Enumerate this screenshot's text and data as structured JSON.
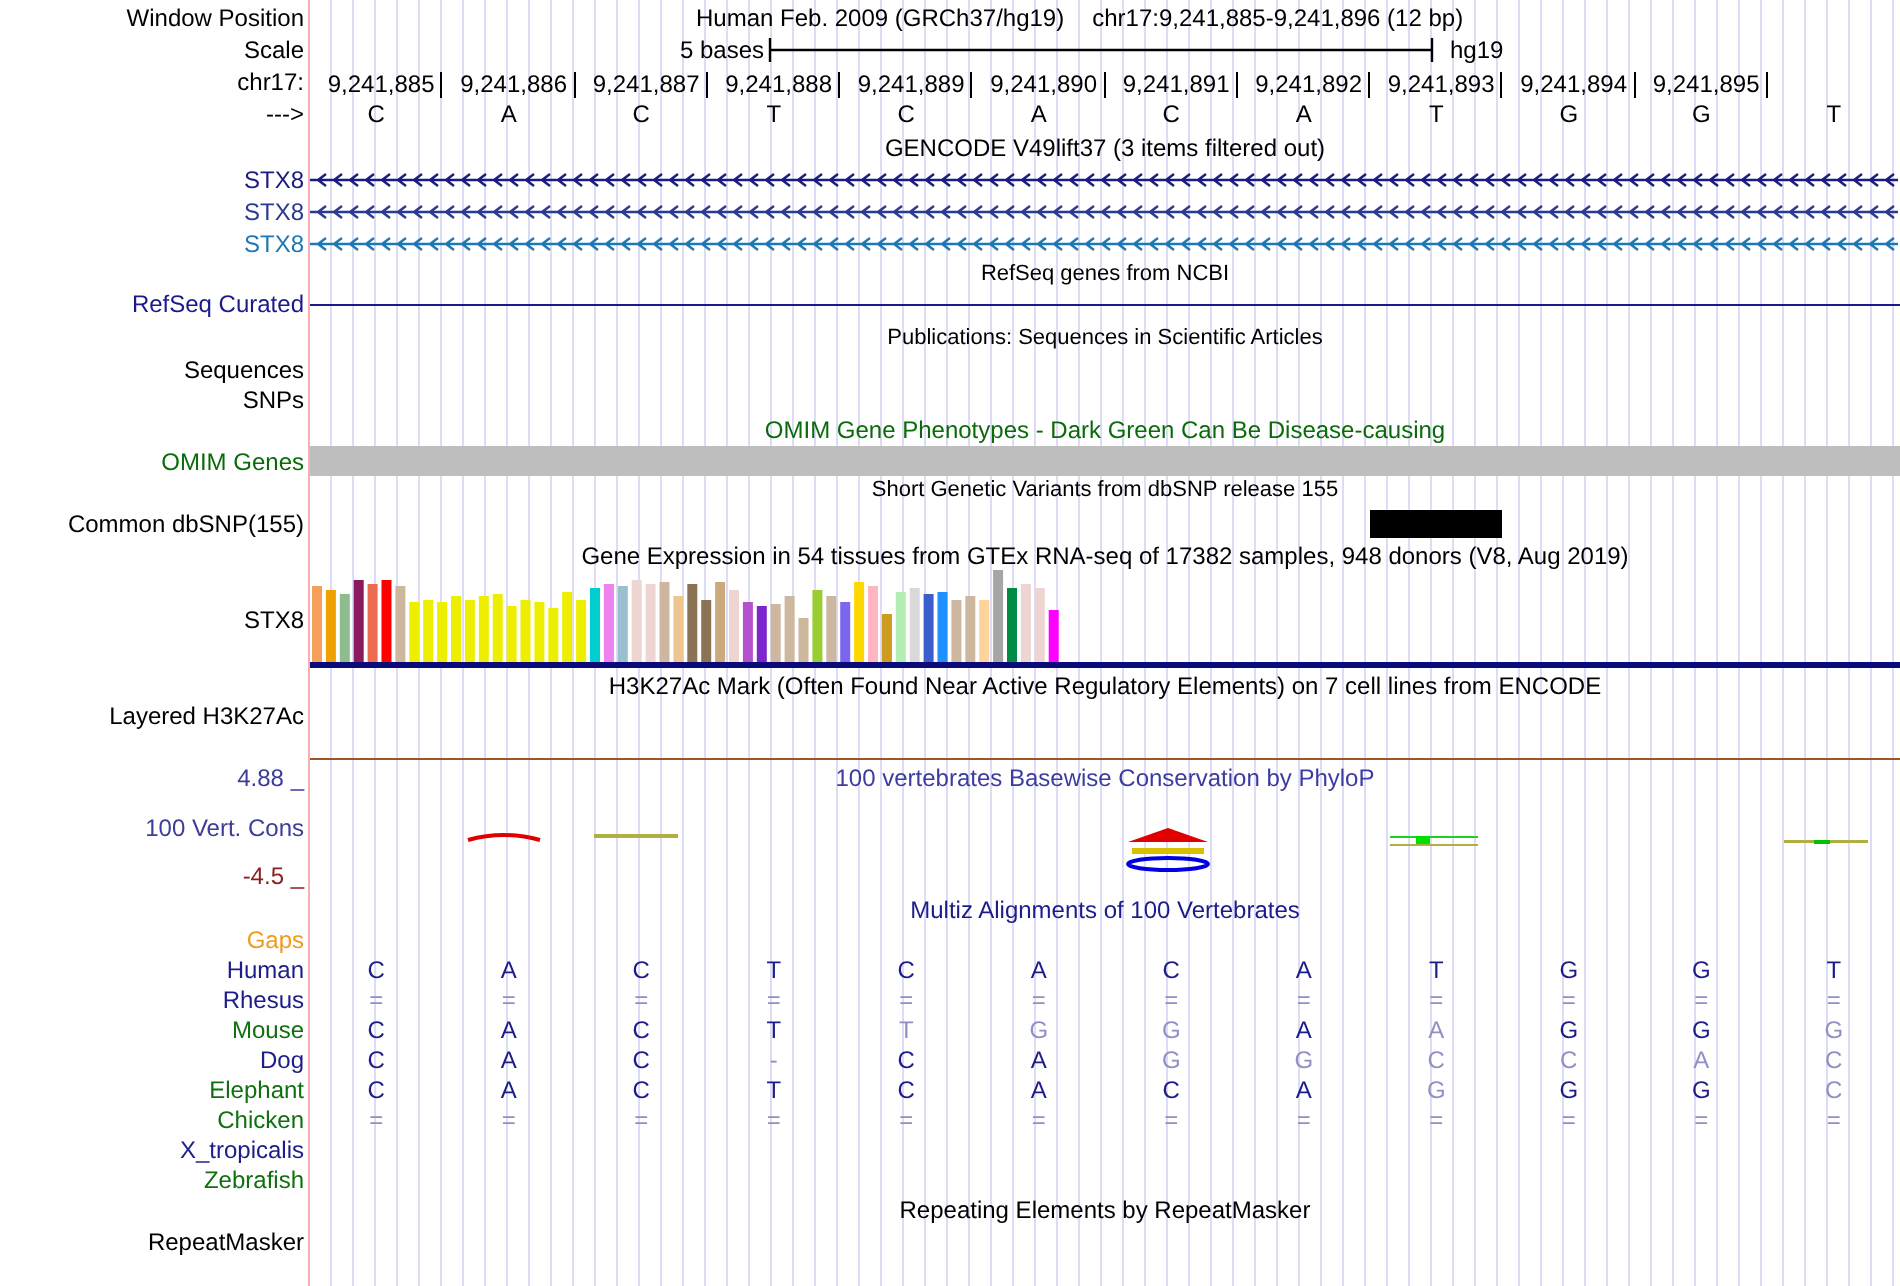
{
  "header": {
    "position_label": "Window Position",
    "title": "Human Feb. 2009 (GRCh37/hg19)",
    "range": "chr17:9,241,885-9,241,896 (12 bp)",
    "scale_label": "Scale",
    "scale_text": "5 bases",
    "assembly": "hg19",
    "chrom_label": "chr17:",
    "positions": [
      "9,241,885",
      "9,241,886",
      "9,241,887",
      "9,241,888",
      "9,241,889",
      "9,241,890",
      "9,241,891",
      "9,241,892",
      "9,241,893",
      "9,241,894",
      "9,241,895"
    ],
    "strand_label": "--->",
    "bases": [
      "C",
      "A",
      "C",
      "T",
      "C",
      "A",
      "C",
      "A",
      "T",
      "G",
      "G",
      "T"
    ]
  },
  "tracks": [
    {
      "kind": "gencode",
      "title": "GENCODE V49lift37 (3 items filtered out)",
      "genes": [
        {
          "label": "STX8",
          "color": "#1c1c80"
        },
        {
          "label": "STX8",
          "color": "#2b3990"
        },
        {
          "label": "STX8",
          "color": "#1f78b4"
        }
      ]
    },
    {
      "kind": "refseq",
      "title": "RefSeq genes from NCBI",
      "label": "RefSeq Curated"
    },
    {
      "kind": "publications",
      "title": "Publications: Sequences in Scientific Articles",
      "labels": [
        "Sequences",
        "SNPs"
      ]
    },
    {
      "kind": "omim",
      "title": "OMIM Gene Phenotypes - Dark Green Can Be Disease-causing",
      "label": "OMIM Genes"
    },
    {
      "kind": "dbsnp",
      "title": "Short Genetic Variants from dbSNP release 155",
      "label": "Common dbSNP(155)"
    },
    {
      "kind": "gtex",
      "title": "Gene Expression in 54 tissues from GTEx RNA-seq of 17382 samples, 948 donors (V8, Aug 2019)",
      "label": "STX8"
    },
    {
      "kind": "h3k27ac",
      "title": "H3K27Ac Mark (Often Found Near Active Regulatory Elements) on 7 cell lines from ENCODE",
      "label": "Layered H3K27Ac"
    },
    {
      "kind": "phylop",
      "title": "100 vertebrates Basewise Conservation by PhyloP",
      "label": "100 Vert. Cons",
      "max": "4.88 _",
      "min": "-4.5 _"
    },
    {
      "kind": "multiz",
      "title": "Multiz Alignments of 100 Vertebrates",
      "species": [
        {
          "name": "Gaps",
          "color": "#f09a1a"
        },
        {
          "name": "Human",
          "color": "#1c1c8a",
          "bases": [
            {
              "b": "C",
              "dim": false
            },
            {
              "b": "A",
              "dim": false
            },
            {
              "b": "C",
              "dim": false
            },
            {
              "b": "T",
              "dim": false
            },
            {
              "b": "C",
              "dim": false
            },
            {
              "b": "A",
              "dim": false
            },
            {
              "b": "C",
              "dim": false
            },
            {
              "b": "A",
              "dim": false
            },
            {
              "b": "T",
              "dim": false
            },
            {
              "b": "G",
              "dim": false
            },
            {
              "b": "G",
              "dim": false
            },
            {
              "b": "T",
              "dim": false
            }
          ]
        },
        {
          "name": "Rhesus",
          "color": "#1c1c8a",
          "bases": [
            {
              "b": "=",
              "dim": true
            },
            {
              "b": "=",
              "dim": true
            },
            {
              "b": "=",
              "dim": true
            },
            {
              "b": "=",
              "dim": true
            },
            {
              "b": "=",
              "dim": true
            },
            {
              "b": "=",
              "dim": true
            },
            {
              "b": "=",
              "dim": true
            },
            {
              "b": "=",
              "dim": true
            },
            {
              "b": "=",
              "dim": true
            },
            {
              "b": "=",
              "dim": true
            },
            {
              "b": "=",
              "dim": true
            },
            {
              "b": "=",
              "dim": true
            }
          ]
        },
        {
          "name": "Mouse",
          "color": "#107010",
          "bases": [
            {
              "b": "C",
              "dim": false
            },
            {
              "b": "A",
              "dim": false
            },
            {
              "b": "C",
              "dim": false
            },
            {
              "b": "T",
              "dim": false
            },
            {
              "b": "T",
              "dim": true
            },
            {
              "b": "G",
              "dim": true
            },
            {
              "b": "G",
              "dim": true
            },
            {
              "b": "A",
              "dim": false
            },
            {
              "b": "A",
              "dim": true
            },
            {
              "b": "G",
              "dim": false
            },
            {
              "b": "G",
              "dim": false
            },
            {
              "b": "G",
              "dim": true
            }
          ]
        },
        {
          "name": "Dog",
          "color": "#1c1c8a",
          "bases": [
            {
              "b": "C",
              "dim": false
            },
            {
              "b": "A",
              "dim": false
            },
            {
              "b": "C",
              "dim": false
            },
            {
              "b": "-",
              "dim": true
            },
            {
              "b": "C",
              "dim": false
            },
            {
              "b": "A",
              "dim": false
            },
            {
              "b": "G",
              "dim": true
            },
            {
              "b": "G",
              "dim": true
            },
            {
              "b": "C",
              "dim": true
            },
            {
              "b": "C",
              "dim": true
            },
            {
              "b": "A",
              "dim": true
            },
            {
              "b": "C",
              "dim": true
            }
          ]
        },
        {
          "name": "Elephant",
          "color": "#107010",
          "bases": [
            {
              "b": "C",
              "dim": false
            },
            {
              "b": "A",
              "dim": false
            },
            {
              "b": "C",
              "dim": false
            },
            {
              "b": "T",
              "dim": false
            },
            {
              "b": "C",
              "dim": false
            },
            {
              "b": "A",
              "dim": false
            },
            {
              "b": "C",
              "dim": false
            },
            {
              "b": "A",
              "dim": false
            },
            {
              "b": "G",
              "dim": true
            },
            {
              "b": "G",
              "dim": false
            },
            {
              "b": "G",
              "dim": false
            },
            {
              "b": "C",
              "dim": true
            }
          ]
        },
        {
          "name": "Chicken",
          "color": "#107010",
          "bases": [
            {
              "b": "=",
              "dim": true
            },
            {
              "b": "=",
              "dim": true
            },
            {
              "b": "=",
              "dim": true
            },
            {
              "b": "=",
              "dim": true
            },
            {
              "b": "=",
              "dim": true
            },
            {
              "b": "=",
              "dim": true
            },
            {
              "b": "=",
              "dim": true
            },
            {
              "b": "=",
              "dim": true
            },
            {
              "b": "=",
              "dim": true
            },
            {
              "b": "=",
              "dim": true
            },
            {
              "b": "=",
              "dim": true
            },
            {
              "b": "=",
              "dim": true
            }
          ]
        },
        {
          "name": "X_tropicalis",
          "color": "#1c1c8a"
        },
        {
          "name": "Zebrafish",
          "color": "#107010"
        }
      ]
    },
    {
      "kind": "repeatmasker",
      "title": "Repeating Elements by RepeatMasker",
      "label": "RepeatMasker"
    }
  ]
}
